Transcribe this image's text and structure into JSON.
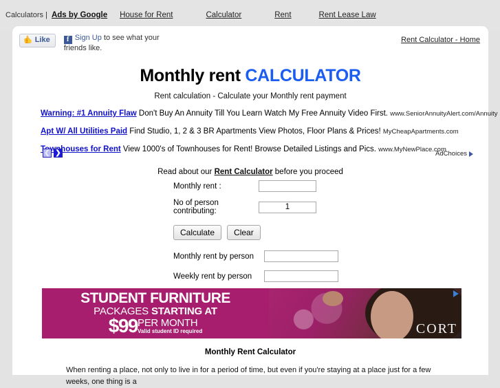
{
  "topbar": {
    "lead": "Calculators |",
    "ads_by_google": "Ads by Google",
    "links": [
      {
        "label": "House for Rent"
      },
      {
        "label": "Calculator"
      },
      {
        "label": "Rent"
      },
      {
        "label": "Rent Lease Law"
      }
    ]
  },
  "social": {
    "like_label": "Like",
    "signup_label": "Sign Up",
    "signup_rest": " to see what your friends like.",
    "fb_icon": "f"
  },
  "header": {
    "home_link": "Rent Calculator - Home",
    "title_main": "Monthly rent ",
    "title_accent": "CALCULATOR",
    "subtitle": "Rent calculation - Calculate your Monthly rent payment",
    "accent_color": "#1a5df0"
  },
  "text_ads": {
    "items": [
      {
        "title": "Warning: #1 Annuity Flaw",
        "desc": " Don't Buy An Annuity Till You Learn Watch My Free Annuity Video First. ",
        "url": "www.SeniorAnnuityAlert.com/Annuity"
      },
      {
        "title": "Apt W/ All Utilities Paid",
        "desc": " Find Studio, 1, 2 & 3 BR Apartments View Photos, Floor Plans & Prices! ",
        "url": "MyCheapApartments.com"
      },
      {
        "title": "Townhouses for Rent",
        "desc": " View 1000's of Townhouses for Rent! Browse Detailed Listings and Pics. ",
        "url": "www.MyNewPlace.com"
      }
    ],
    "prev_arrow": "❮",
    "next_arrow": "❯",
    "adchoices_label": "AdChoices"
  },
  "calculator": {
    "read_about_prefix": "Read about our ",
    "read_about_link": "Rent Calculator",
    "read_about_suffix": " before you proceed",
    "monthly_rent_label": "Monthly rent :",
    "monthly_rent_value": "",
    "persons_label": "No of person contributing:",
    "persons_value": "1",
    "calculate_label": "Calculate",
    "clear_label": "Clear",
    "monthly_per_person_label": "Monthly rent by person",
    "monthly_per_person_value": "",
    "weekly_per_person_label": "Weekly rent by person",
    "weekly_per_person_value": ""
  },
  "banner": {
    "line1": "STUDENT FURNITURE",
    "line2_a": "PACKAGES ",
    "line2_b": "STARTING AT",
    "price": "$99",
    "per_month": "PER MONTH",
    "fine_print": "Valid student ID required",
    "brand": "CORT",
    "bg_color": "#a81e6e"
  },
  "article": {
    "heading": "Monthly Rent Calculator",
    "body": "When renting a place, not only to live in for a period of time, but even if you're staying at a place just for a few weeks, one thing is a"
  }
}
